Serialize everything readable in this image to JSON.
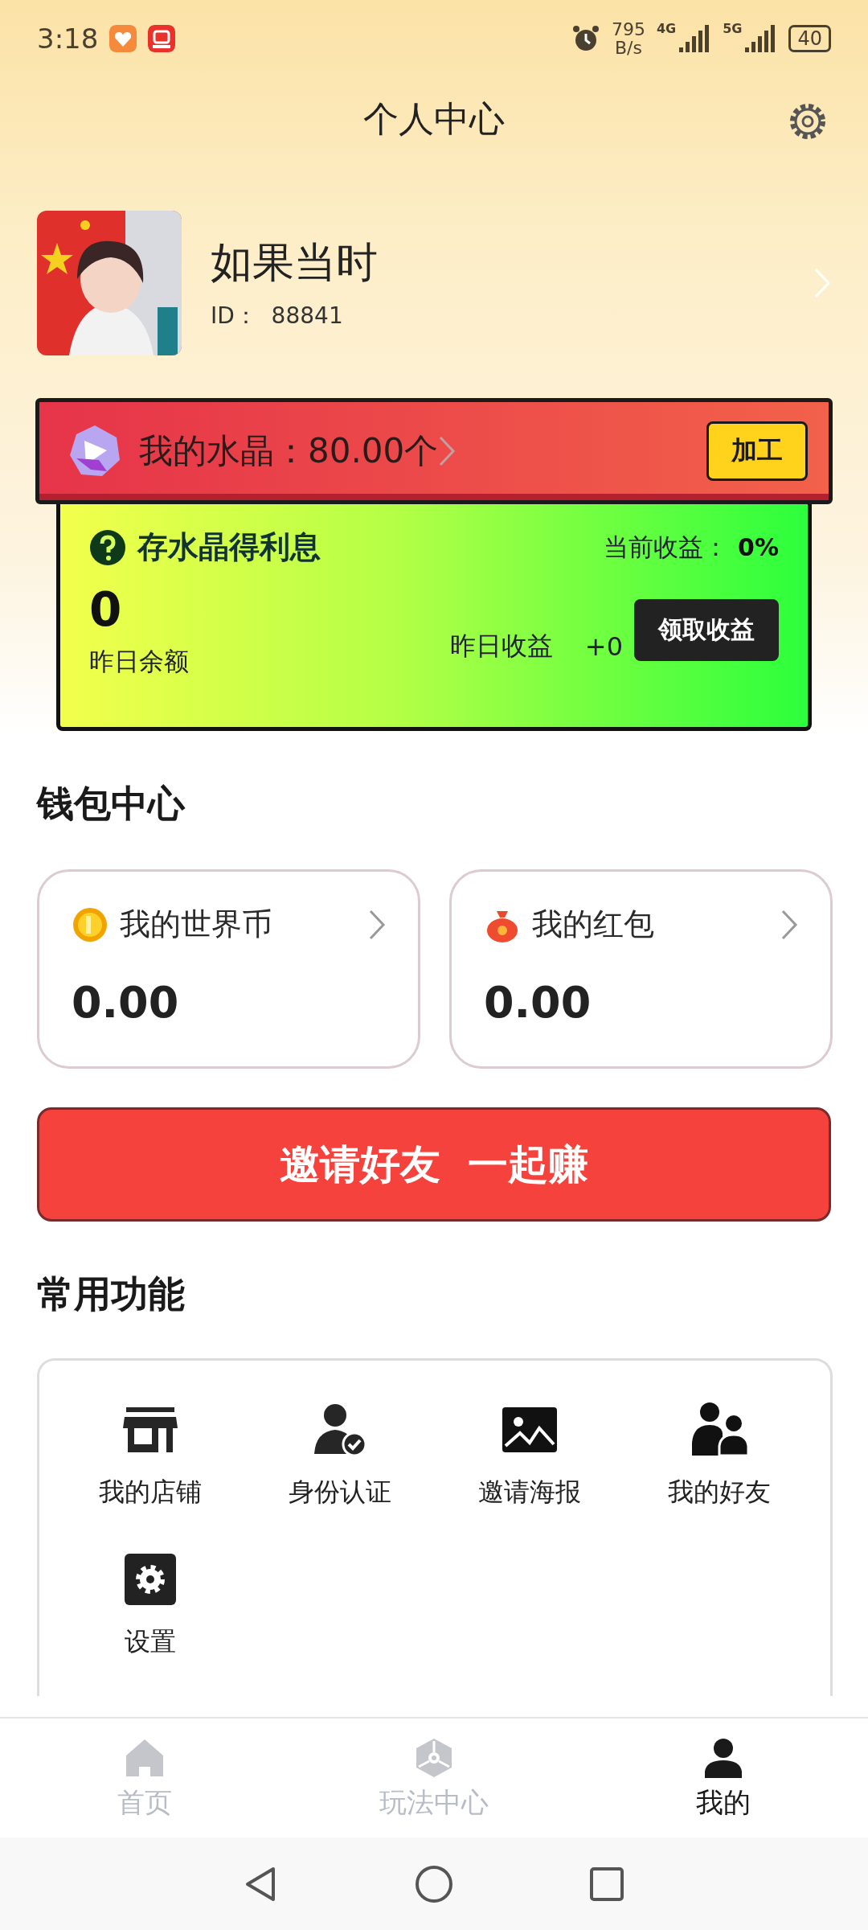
{
  "status_bar": {
    "time": "3:18",
    "net_speed": "795",
    "net_unit": "B/s",
    "network_1": "4G",
    "network_2": "5G",
    "battery": "40"
  },
  "header": {
    "title": "个人中心"
  },
  "profile": {
    "name": "如果当时",
    "id_text": "ID：  88841"
  },
  "crystal": {
    "label": "我的水晶：80.00个",
    "button": "加工"
  },
  "interest": {
    "title": "存水晶得利息",
    "rate_label": "当前收益：",
    "rate_value": "0%",
    "balance": "0",
    "balance_label": "昨日余额",
    "yesterday_label": "昨日收益",
    "yesterday_value": "+0",
    "claim_button": "领取收益"
  },
  "wallet": {
    "title": "钱包中心",
    "cards": [
      {
        "kind": "coin",
        "label": "我的世界币",
        "amount": "0.00"
      },
      {
        "kind": "redpacket",
        "label": "我的红包",
        "amount": "0.00"
      }
    ]
  },
  "invite_button": "邀请好友  一起赚",
  "functions": {
    "title": "常用功能",
    "items": [
      {
        "kind": "store",
        "label": "我的店铺"
      },
      {
        "kind": "verify",
        "label": "身份认证"
      },
      {
        "kind": "poster",
        "label": "邀请海报"
      },
      {
        "kind": "friends",
        "label": "我的好友"
      },
      {
        "kind": "settings",
        "label": "设置"
      }
    ]
  },
  "tab_bar": [
    {
      "kind": "home",
      "label": "首页",
      "selected": false
    },
    {
      "kind": "play",
      "label": "玩法中心",
      "selected": false
    },
    {
      "kind": "me",
      "label": "我的",
      "selected": true
    }
  ]
}
